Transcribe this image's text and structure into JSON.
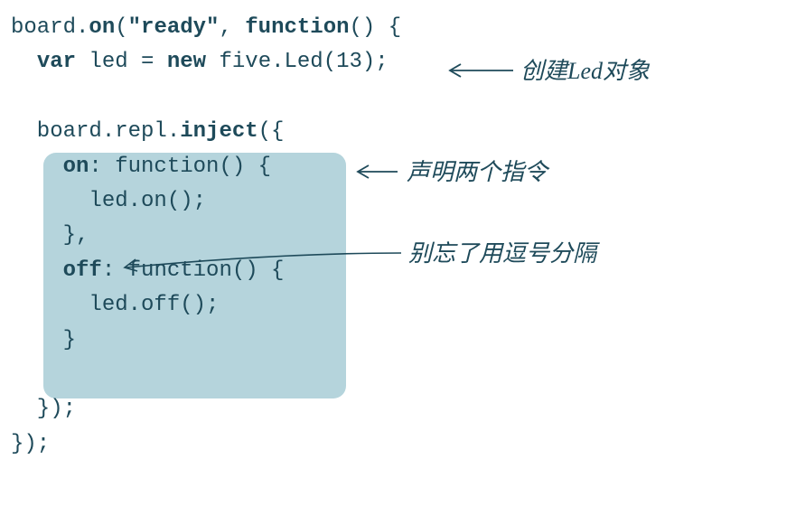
{
  "code": {
    "l1a": "board.",
    "l1b": "on",
    "l1c": "(",
    "l1d": "\"ready\"",
    "l1e": ", ",
    "l1f": "function",
    "l1g": "() {",
    "l2a": "  ",
    "l2b": "var",
    "l2c": " led = ",
    "l2d": "new",
    "l2e": " five.Led(13);",
    "blank1": "",
    "l3a": "  board.repl.",
    "l3b": "inject",
    "l3c": "({",
    "l4a": "    ",
    "l4b": "on",
    "l4c": ": function() {",
    "l5": "      led.on();",
    "l6": "    },",
    "l7a": "    ",
    "l7b": "off",
    "l7c": ": function() {",
    "l8": "      led.off();",
    "l9": "    }",
    "blank2": "",
    "l10": "  });",
    "l11": "});"
  },
  "annotations": {
    "a1": "创建Led对象",
    "a2": "声明两个指令",
    "a3": "别忘了用逗号分隔"
  },
  "colors": {
    "text": "#1e4a5a",
    "highlight": "#b5d4dc"
  }
}
